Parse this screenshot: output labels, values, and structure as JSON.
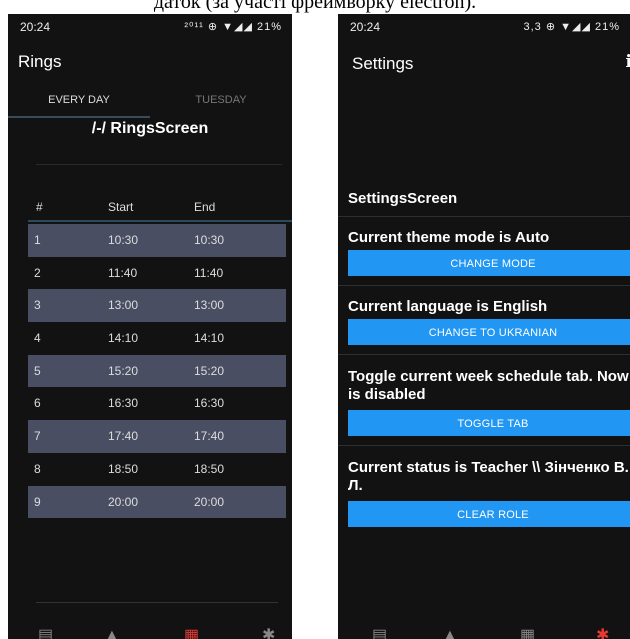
{
  "caption": "даток (за участі фреймворку electron).",
  "left": {
    "status_time": "20:24",
    "status_icons": "²⁰¹¹ ⊕ ▼◢◢ 21%",
    "title": "Rings",
    "tabs": [
      {
        "label": "EVERY DAY"
      },
      {
        "label": "TUESDAY"
      }
    ],
    "screen_title": "/-/ RingsScreen",
    "columns": [
      "#",
      "Start",
      "End"
    ],
    "rows": [
      {
        "n": "1",
        "start": "10:30",
        "end": "10:30"
      },
      {
        "n": "2",
        "start": "11:40",
        "end": "11:40"
      },
      {
        "n": "3",
        "start": "13:00",
        "end": "13:00"
      },
      {
        "n": "4",
        "start": "14:10",
        "end": "14:10"
      },
      {
        "n": "5",
        "start": "15:20",
        "end": "15:20"
      },
      {
        "n": "6",
        "start": "16:30",
        "end": "16:30"
      },
      {
        "n": "7",
        "start": "17:40",
        "end": "17:40"
      },
      {
        "n": "8",
        "start": "18:50",
        "end": "18:50"
      },
      {
        "n": "9",
        "start": "20:00",
        "end": "20:00"
      }
    ],
    "nav_icons": [
      "book-icon",
      "graduation-cap-icon",
      "calendar-icon",
      "gear-icon"
    ],
    "nav_active_color": "#e53935"
  },
  "right": {
    "status_time": "20:24",
    "status_icons": "3,3 ⊕ ▼◢◢ 21%",
    "title": "Settings",
    "info_icon": "i",
    "screen_title": "SettingsScreen",
    "settings": [
      {
        "text": "Current theme mode is Auto",
        "button": "CHANGE MODE"
      },
      {
        "text": "Current language is English",
        "button": "CHANGE TO UKRANIAN"
      },
      {
        "text": "Toggle current week schedule tab. Now is disabled",
        "button": "TOGGLE TAB"
      },
      {
        "text": "Current status is Teacher \\\\ Зінченко В. Л.",
        "button": "CLEAR ROLE"
      }
    ],
    "button_color": "#2196f3"
  }
}
